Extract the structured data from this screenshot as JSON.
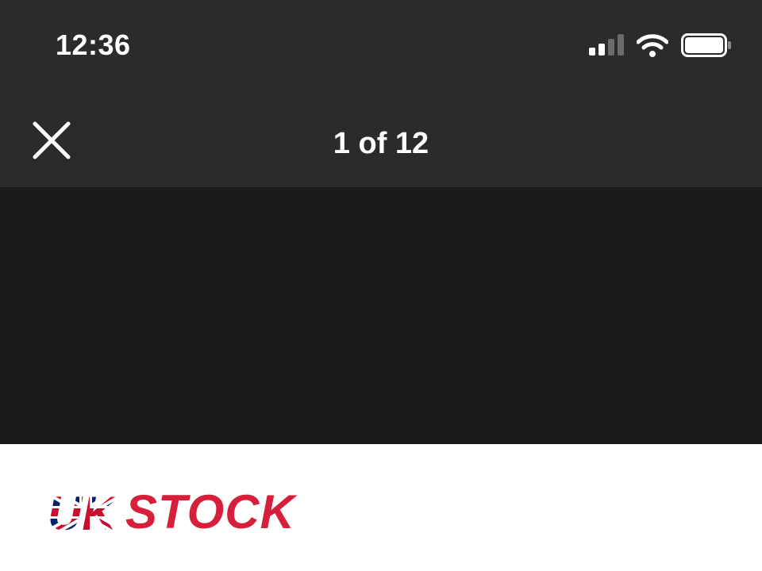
{
  "status_bar": {
    "time": "12:36",
    "icons": [
      "cellular-signal-icon",
      "wifi-icon",
      "battery-icon"
    ]
  },
  "nav_bar": {
    "close_icon": "close-icon",
    "page_counter": "1 of 12"
  },
  "document": {
    "logo_text_flag": "UK",
    "logo_text": "STOCK",
    "logo_color": "#d61f3a",
    "flag_colors": {
      "blue": "#012169",
      "red": "#c8102e",
      "white": "#ffffff"
    }
  },
  "colors": {
    "chrome_background": "#2b2b2b",
    "media_background": "#1a1a1a",
    "document_background": "#ffffff"
  }
}
